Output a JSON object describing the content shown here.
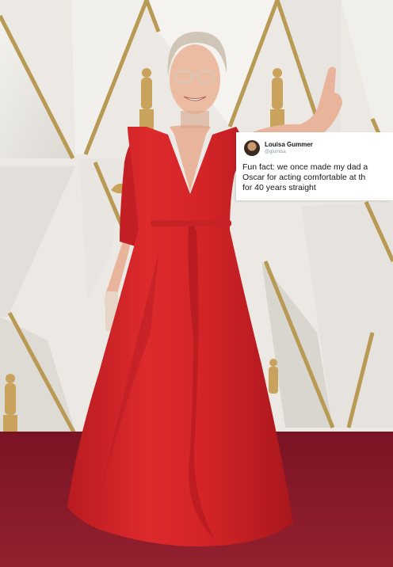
{
  "photo": {
    "colors": {
      "wall": "#efede9",
      "wall_shadow": "#d9d6d1",
      "gold_trim": "#b89a55",
      "statuette": "#c9a35c",
      "carpet": "#8a1c2c",
      "dress": "#d8262a",
      "dress_shadow": "#a8171c",
      "skin": "#e8b59c",
      "hair": "#cfc6b8"
    }
  },
  "tweet": {
    "display_name": "Louisa Gummer",
    "handle": "@glumisa",
    "lines": [
      "Fun fact: we once made my dad a",
      "Oscar for acting comfortable at th",
      "for 40 years straight"
    ]
  }
}
